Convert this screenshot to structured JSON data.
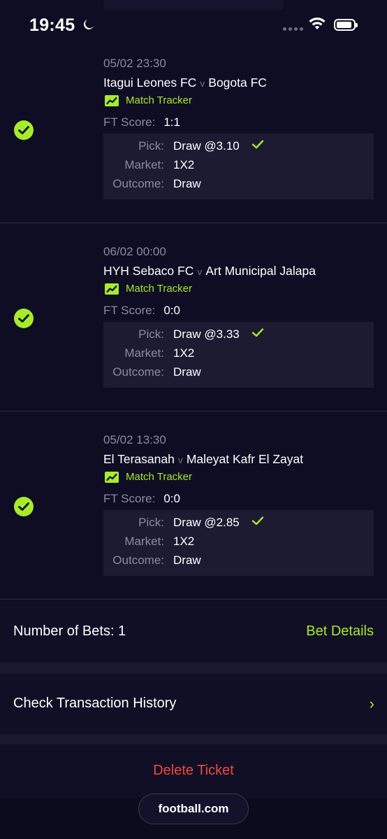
{
  "status_bar": {
    "time": "19:45"
  },
  "colors": {
    "accent": "#a6ec2a",
    "danger": "#f04a3c",
    "background": "#0f0d24"
  },
  "bets": [
    {
      "datetime": "05/02 23:30",
      "home": "Itagui Leones FC",
      "vs": "v",
      "away": "Bogota FC",
      "tracker": "Match Tracker",
      "ft_label": "FT Score:",
      "ft_score": "1:1",
      "pick_label": "Pick:",
      "pick": "Draw @3.10",
      "market_label": "Market:",
      "market": "1X2",
      "outcome_label": "Outcome:",
      "outcome": "Draw",
      "status_icon": "check-circle-icon"
    },
    {
      "datetime": "06/02 00:00",
      "home": "HYH Sebaco FC",
      "vs": "v",
      "away": "Art Municipal Jalapa",
      "tracker": "Match Tracker",
      "ft_label": "FT Score:",
      "ft_score": "0:0",
      "pick_label": "Pick:",
      "pick": "Draw @3.33",
      "market_label": "Market:",
      "market": "1X2",
      "outcome_label": "Outcome:",
      "outcome": "Draw",
      "status_icon": "check-circle-icon"
    },
    {
      "datetime": "05/02 13:30",
      "home": "El Terasanah",
      "vs": "v",
      "away": "Maleyat Kafr El Zayat",
      "tracker": "Match Tracker",
      "ft_label": "FT Score:",
      "ft_score": "0:0",
      "pick_label": "Pick:",
      "pick": "Draw @2.85",
      "market_label": "Market:",
      "market": "1X2",
      "outcome_label": "Outcome:",
      "outcome": "Draw",
      "status_icon": "check-circle-icon"
    }
  ],
  "summary": {
    "number_of_bets": "Number of Bets: 1",
    "bet_details": "Bet Details"
  },
  "history": {
    "label": "Check Transaction History",
    "chevron": "›"
  },
  "delete": {
    "label": "Delete Ticket"
  },
  "brand": {
    "url": "football.com"
  }
}
